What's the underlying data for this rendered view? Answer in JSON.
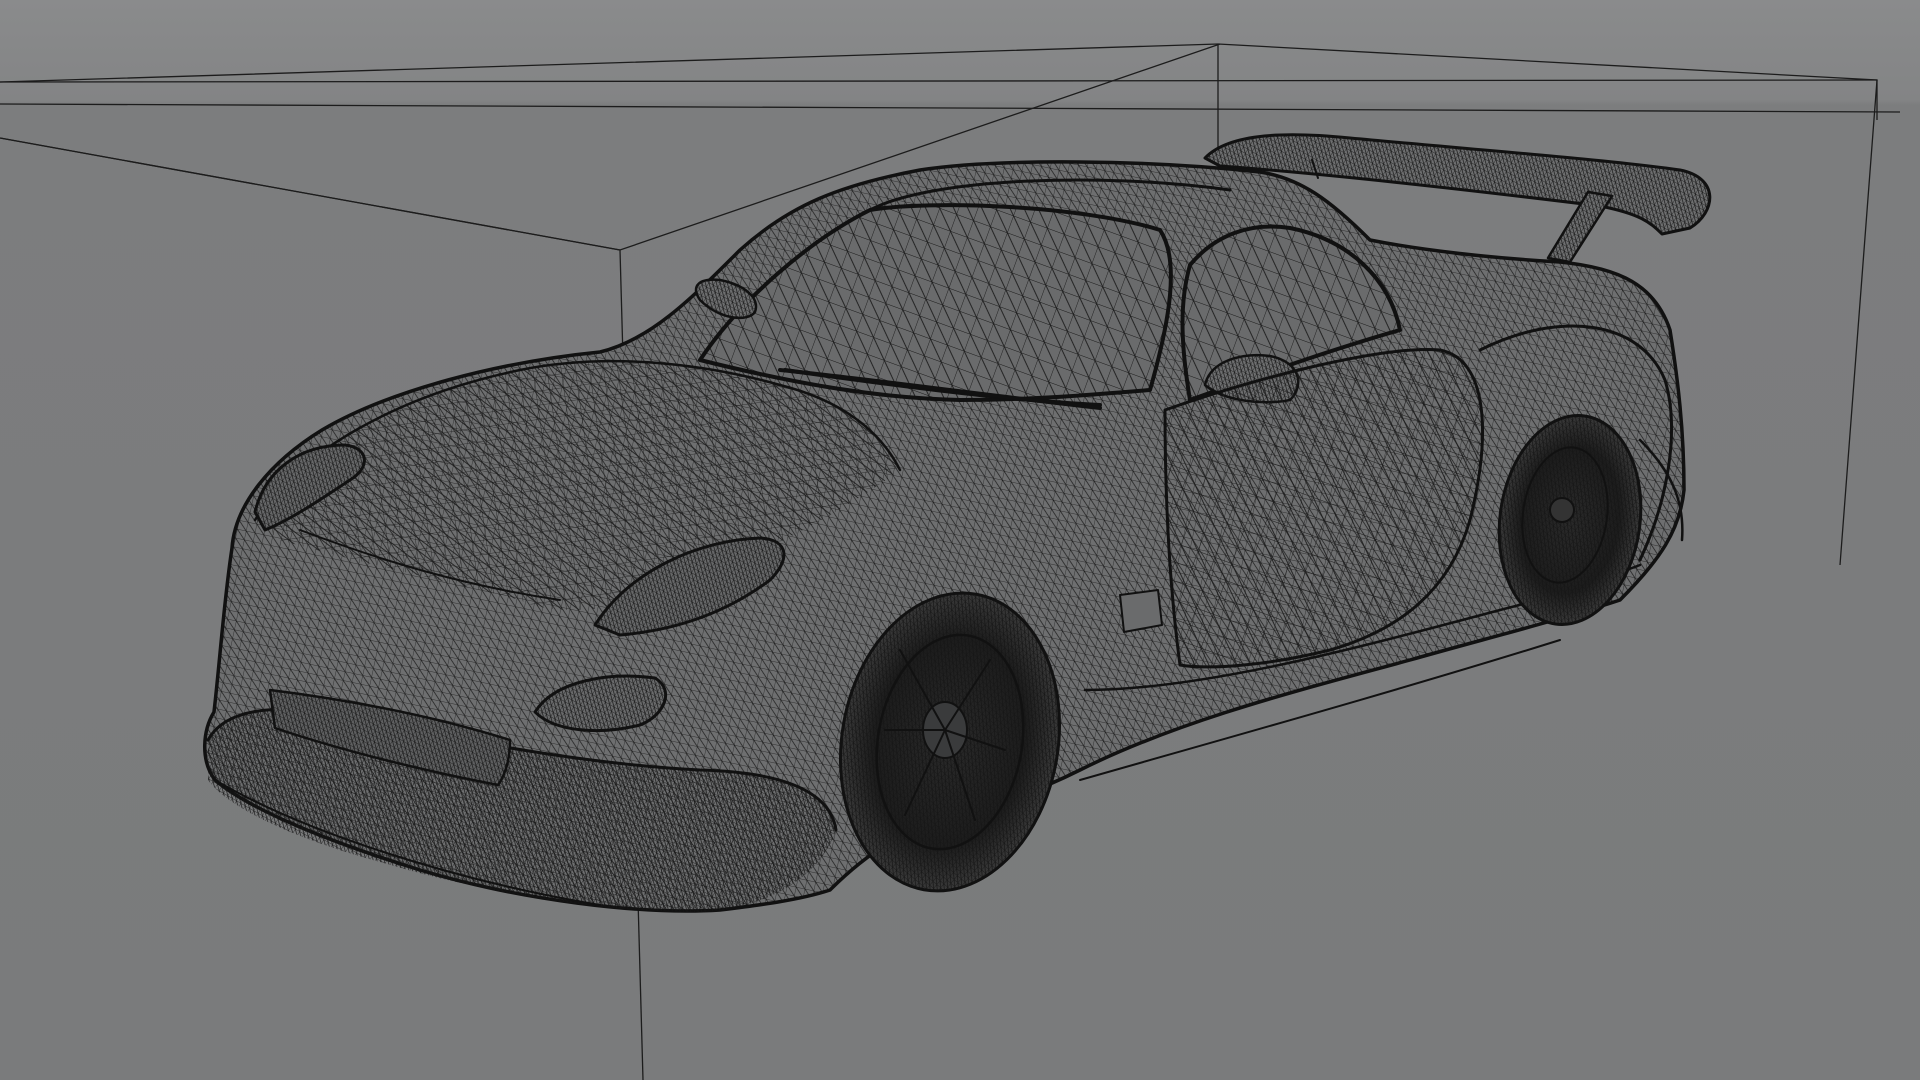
{
  "viewport": {
    "background_color": "#7c7d7e",
    "wire_color": "#141414",
    "body_color": "#6e6f70"
  },
  "scene": {
    "objects": [
      {
        "type": "car-model",
        "display": "wireframe-on-shaded"
      },
      {
        "type": "bounding-box",
        "display": "lines"
      }
    ]
  }
}
